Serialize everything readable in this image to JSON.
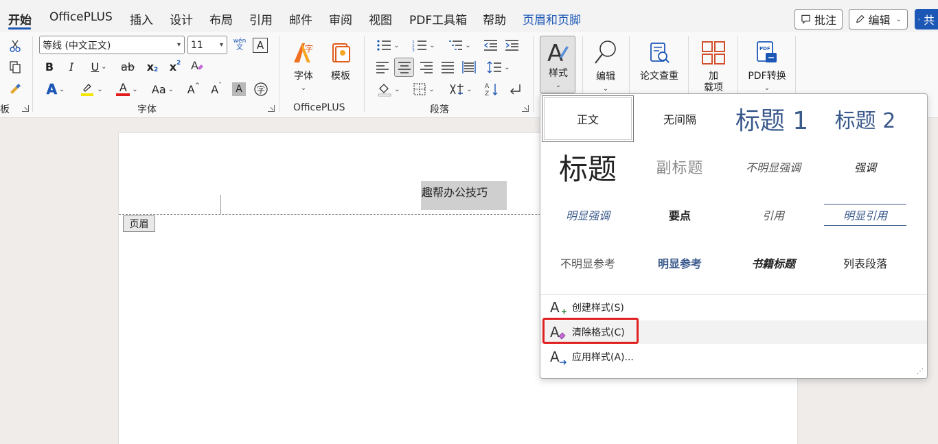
{
  "menubar": {
    "tabs": [
      "开始",
      "OfficePLUS",
      "插入",
      "设计",
      "布局",
      "引用",
      "邮件",
      "审阅",
      "视图",
      "PDF工具箱",
      "帮助",
      "页眉和页脚"
    ],
    "comment_btn": "批注",
    "edit_btn": "编辑",
    "share_btn": "共"
  },
  "ribbon": {
    "clipboard_label": "板",
    "font_name": "等线 (中文正文)",
    "font_size": "11",
    "wen_top": "wén",
    "wen_bottom": "文",
    "bold": "B",
    "italic": "I",
    "underline": "U",
    "strike": "ab",
    "sub": "x",
    "sub_small": "2",
    "sup": "x",
    "sup_small": "2",
    "font_color_letter": "A",
    "change_case": "Aa",
    "grow_font": "A",
    "shrink_font": "A",
    "font_label": "字体",
    "officeplus_font": "字体",
    "officeplus_template": "模板",
    "officeplus_label": "OfficePLUS",
    "paragraph_label": "段落",
    "styles_btn": "样式",
    "edit_group": "编辑",
    "paper_check": "论文查重",
    "addin_line1": "加",
    "addin_line2": "载项",
    "pdf_convert": "PDF转换",
    "pdf_small": "PDF"
  },
  "document": {
    "header_text": "趣帮办公技巧",
    "header_tag": "页眉"
  },
  "gallery": {
    "styles": [
      {
        "label": "正文"
      },
      {
        "label": "无间隔"
      },
      {
        "label": "标题 1"
      },
      {
        "label": "标题 2"
      },
      {
        "label": "标题"
      },
      {
        "label": "副标题"
      },
      {
        "label": "不明显强调"
      },
      {
        "label": "强调"
      },
      {
        "label": "明显强调"
      },
      {
        "label": "要点"
      },
      {
        "label": "引用"
      },
      {
        "label": "明显引用"
      },
      {
        "label": "不明显参考"
      },
      {
        "label": "明显参考"
      },
      {
        "label": "书籍标题"
      },
      {
        "label": "列表段落"
      }
    ],
    "create_style": "创建样式(S)",
    "clear_format": "清除格式(C)",
    "apply_style": "应用样式(A)..."
  },
  "colors": {
    "accent": "#1c57b5",
    "highlight_red": "#e02020",
    "heading_blue": "#3b5a8c"
  }
}
